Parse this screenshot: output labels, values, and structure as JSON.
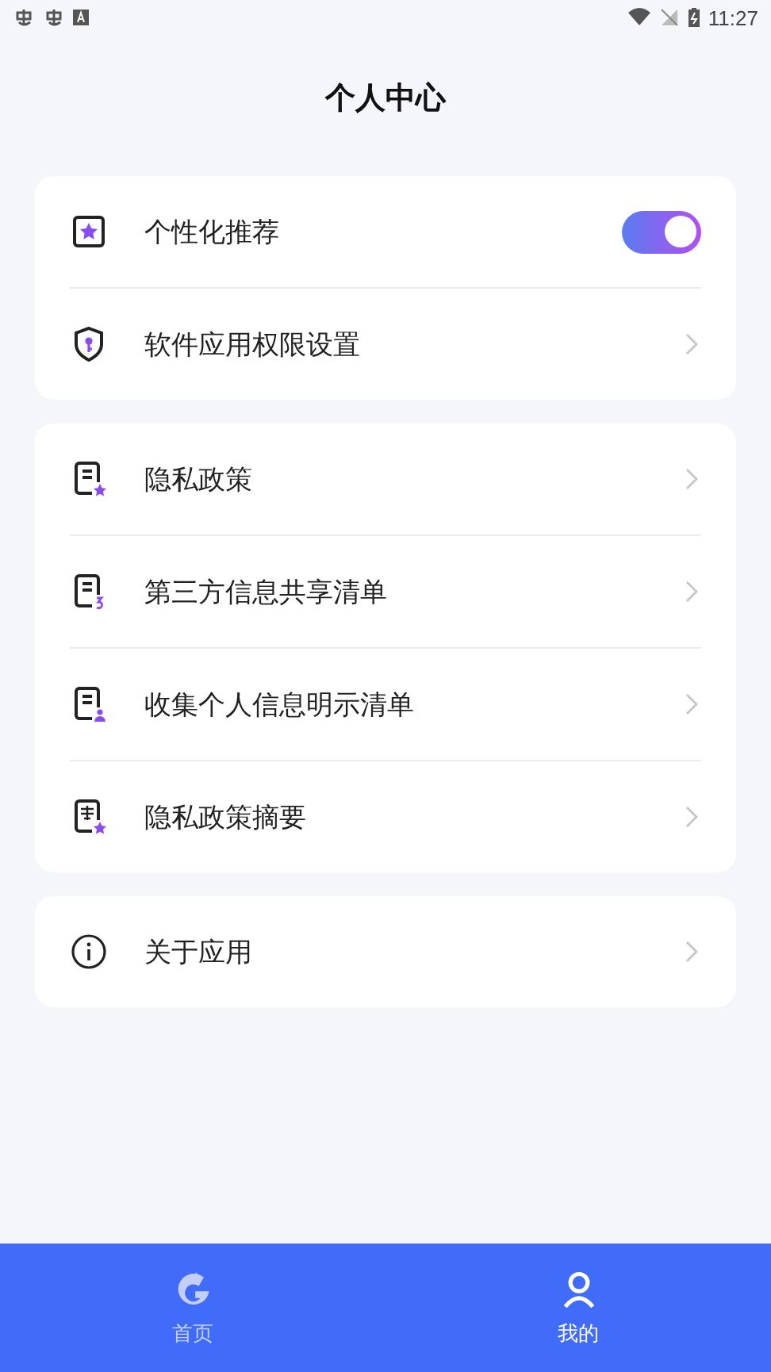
{
  "status_bar": {
    "time": "11:27"
  },
  "title": "个人中心",
  "groups": [
    {
      "items": [
        {
          "kind": "toggle",
          "label": "个性化推荐",
          "on": true
        },
        {
          "kind": "link",
          "label": "软件应用权限设置"
        }
      ]
    },
    {
      "items": [
        {
          "kind": "link",
          "label": "隐私政策"
        },
        {
          "kind": "link",
          "label": "第三方信息共享清单"
        },
        {
          "kind": "link",
          "label": "收集个人信息明示清单"
        },
        {
          "kind": "link",
          "label": "隐私政策摘要"
        }
      ]
    },
    {
      "items": [
        {
          "kind": "link",
          "label": "关于应用"
        }
      ]
    }
  ],
  "bottom_nav": [
    {
      "label": "首页",
      "selected": false
    },
    {
      "label": "我的",
      "selected": true
    }
  ]
}
